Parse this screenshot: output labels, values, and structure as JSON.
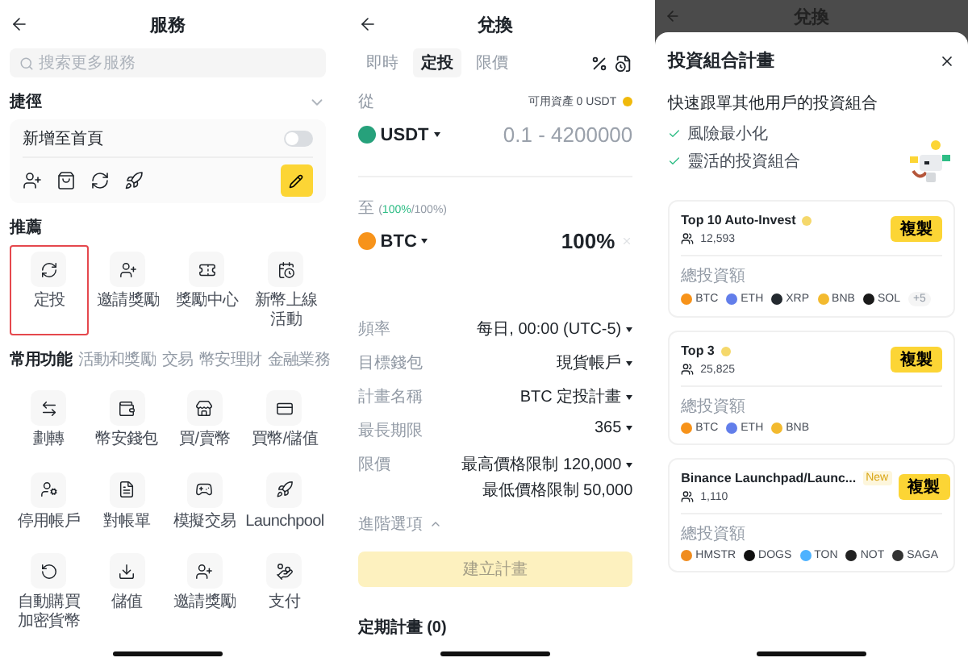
{
  "services": {
    "title": "服務",
    "search": {
      "placeholder": "搜索更多服務"
    },
    "shortcuts": {
      "title": "捷徑",
      "add_to_home": {
        "label": "新增至首頁",
        "on": false
      }
    },
    "recommended": {
      "title": "推薦",
      "items": [
        {
          "label": "定投",
          "selected": true
        },
        {
          "label": "邀請獎勵",
          "selected": false
        },
        {
          "label": "獎勵中心",
          "selected": false
        },
        {
          "label": "新幣上線活動",
          "selected": false
        }
      ]
    },
    "tabs": [
      {
        "label": "常用功能",
        "selected": true
      },
      {
        "label": "活動和獎勵",
        "selected": false
      },
      {
        "label": "交易",
        "selected": false
      },
      {
        "label": "幣安理財",
        "selected": false
      },
      {
        "label": "金融業務",
        "selected": false
      }
    ],
    "features": [
      {
        "label": "劃轉"
      },
      {
        "label": "幣安錢包"
      },
      {
        "label": "買/賣幣"
      },
      {
        "label": "買幣/儲值"
      },
      {
        "label": "停用帳戶"
      },
      {
        "label": "對帳單"
      },
      {
        "label": "模擬交易"
      },
      {
        "label": "Launchpool"
      },
      {
        "label": "自動購買加密貨幣"
      },
      {
        "label": "儲值"
      },
      {
        "label": "邀請獎勵"
      },
      {
        "label": "支付"
      }
    ]
  },
  "convert": {
    "title": "兌換",
    "tabs": [
      {
        "label": "即時",
        "selected": false
      },
      {
        "label": "定投",
        "selected": true
      },
      {
        "label": "限價",
        "selected": false
      }
    ],
    "from": {
      "label": "從",
      "available": "可用資產 0 USDT",
      "coin": "USDT",
      "color": "#26a17b",
      "placeholder": "0.1 - 4200000"
    },
    "to": {
      "label": "至",
      "open": "(",
      "allocated": "100%",
      "total": "/100%)",
      "coin": "BTC",
      "color": "#f7931a",
      "value": "100%"
    },
    "settings": [
      {
        "label": "頻率",
        "values": [
          "每日, 00:00 (UTC-5)"
        ]
      },
      {
        "label": "目標錢包",
        "values": [
          "現貨帳戶"
        ]
      },
      {
        "label": "計畫名稱",
        "values": [
          "BTC 定投計畫"
        ]
      },
      {
        "label": "最長期限",
        "values": [
          "365"
        ]
      },
      {
        "label": "限價",
        "values": [
          "最高價格限制 120,000",
          "最低價格限制 50,000"
        ]
      }
    ],
    "advanced": "進階選項",
    "create_button": {
      "label": "建立計畫",
      "disabled": true
    },
    "plans_title": "定期計畫 (0)"
  },
  "portfolio": {
    "backdrop_title": "兌換",
    "title": "投資組合計畫",
    "subtitle": "快速跟單其他用戶的投資組合",
    "benefits": [
      "風險最小化",
      "靈活的投資組合"
    ],
    "plans": [
      {
        "name": "Top 10 Auto-Invest",
        "users": "12,593",
        "copy": "複製",
        "allocation_label": "總投資額",
        "more": "+5",
        "coins": [
          {
            "name": "BTC",
            "color": "#f7931a"
          },
          {
            "name": "ETH",
            "color": "#627eea"
          },
          {
            "name": "XRP",
            "color": "#23292f"
          },
          {
            "name": "BNB",
            "color": "#f3ba2f"
          },
          {
            "name": "SOL",
            "color": "#1a1a1a"
          }
        ]
      },
      {
        "name": "Top 3",
        "users": "25,825",
        "copy": "複製",
        "allocation_label": "總投資額",
        "coins": [
          {
            "name": "BTC",
            "color": "#f7931a"
          },
          {
            "name": "ETH",
            "color": "#627eea"
          },
          {
            "name": "BNB",
            "color": "#f3ba2f"
          }
        ]
      },
      {
        "name": "Binance Launchpad/Launc...",
        "badge": "New",
        "users": "1,110",
        "copy": "複製",
        "allocation_label": "總投資額",
        "coins": [
          {
            "name": "HMSTR",
            "color": "#f08c1e"
          },
          {
            "name": "DOGS",
            "color": "#111111"
          },
          {
            "name": "TON",
            "color": "#4db2ff"
          },
          {
            "name": "NOT",
            "color": "#222222"
          },
          {
            "name": "SAGA",
            "color": "#333333"
          }
        ]
      }
    ]
  }
}
